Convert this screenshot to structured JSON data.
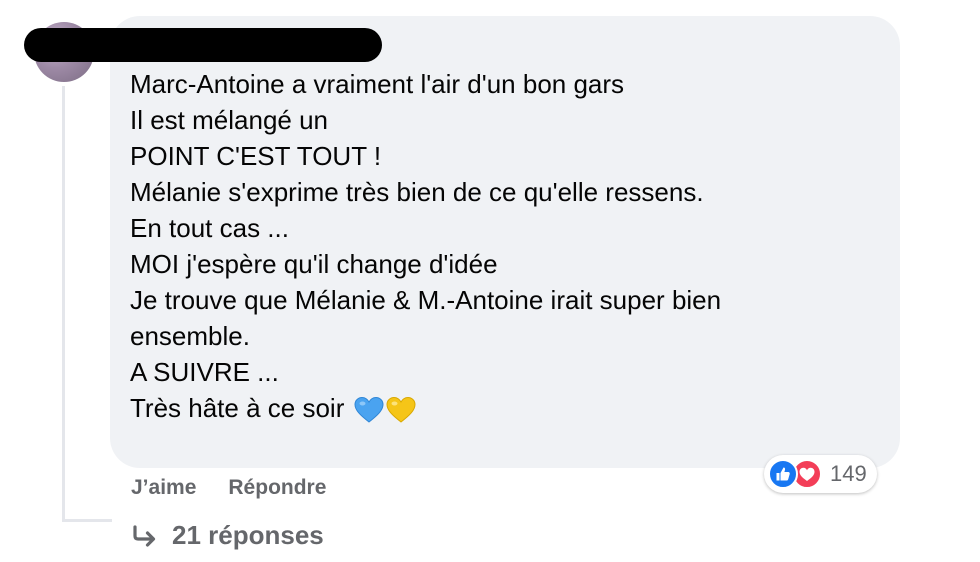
{
  "comment": {
    "lines": [
      "Marc-Antoine a vraiment l'air d'un bon gars",
      "Il est mélangé un",
      "POINT C'EST TOUT !",
      "Mélanie s'exprime très bien de ce qu'elle ressens.",
      "En tout cas ...",
      "MOI j'espère qu'il change d'idée",
      "Je trouve que Mélanie & M.-Antoine irait super bien",
      "ensemble.",
      "A SUIVRE ...",
      "Très hâte à ce soir"
    ],
    "emojis": [
      "blue-heart-icon",
      "yellow-heart-icon"
    ]
  },
  "actions": {
    "like_label": "J’aime",
    "reply_label": "Répondre"
  },
  "reactions": {
    "icons": [
      "like-icon",
      "love-icon"
    ],
    "count": "149"
  },
  "replies": {
    "label": "21 réponses"
  },
  "colors": {
    "bubble_bg": "#f0f2f5",
    "secondary_text": "#65676b",
    "like_blue": "#1877f2",
    "love_red": "#f33e58",
    "blue_heart": "#4aa3f0",
    "yellow_heart": "#f5c518"
  }
}
